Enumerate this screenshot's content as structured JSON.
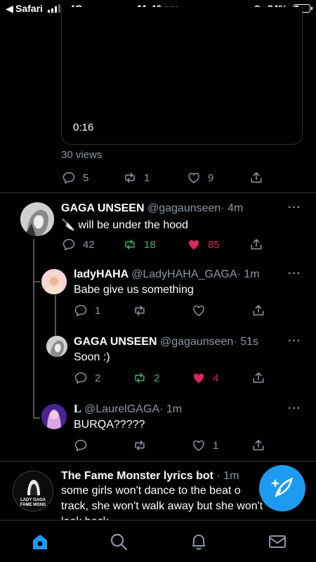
{
  "status_bar": {
    "carrier": "Safari",
    "network": "4G",
    "time": "11:46 pm",
    "battery": "24%",
    "battery_level": 0.24
  },
  "prev_tweet": {
    "video_duration": "0:16",
    "views": "30 views",
    "replies": "5",
    "retweets": "1",
    "likes": "9"
  },
  "tweet_main": {
    "name": "GAGA UNSEEN",
    "handle": "@gagaunseen",
    "time": "· 4m",
    "text": "🔪 will be under the hood",
    "replies": "42",
    "retweets": "18",
    "likes": "85",
    "retweeted": true,
    "liked": true
  },
  "reply_1": {
    "name": "ladyHAHA",
    "handle": "@LadyHAHA_GAGA",
    "time": "· 1m",
    "text": "Babe give us something",
    "replies": "1",
    "retweets": "",
    "likes": ""
  },
  "reply_2": {
    "name": "GAGA UNSEEN",
    "handle": "@gagaunseen",
    "time": "· 51s",
    "text": "Soon :)",
    "replies": "2",
    "retweets": "2",
    "likes": "4",
    "retweeted": true,
    "liked": true
  },
  "reply_3": {
    "name": "L",
    "handle": "@LaurelGAGA",
    "time": "· 1m",
    "text": "BURQA?????",
    "replies": "",
    "retweets": "",
    "likes": "1"
  },
  "tweet_bot": {
    "name": "The Fame Monster lyrics bot",
    "time": "· 1m",
    "line1": "some girls won't dance to the beat o",
    "line2": "track, she won't walk away but she won't",
    "line3": "look back",
    "avatar_text": "LADY GAGA FAME MONS"
  },
  "colors": {
    "accent": "#1d9bf0",
    "retweet_green": "#3bb36b",
    "like_pink": "#e0245e",
    "muted": "#8b98a5"
  },
  "icons": [
    "reply-icon",
    "retweet-icon",
    "like-icon",
    "share-icon",
    "more-icon",
    "compose-icon",
    "home-icon",
    "search-icon",
    "notifications-icon",
    "messages-icon"
  ]
}
